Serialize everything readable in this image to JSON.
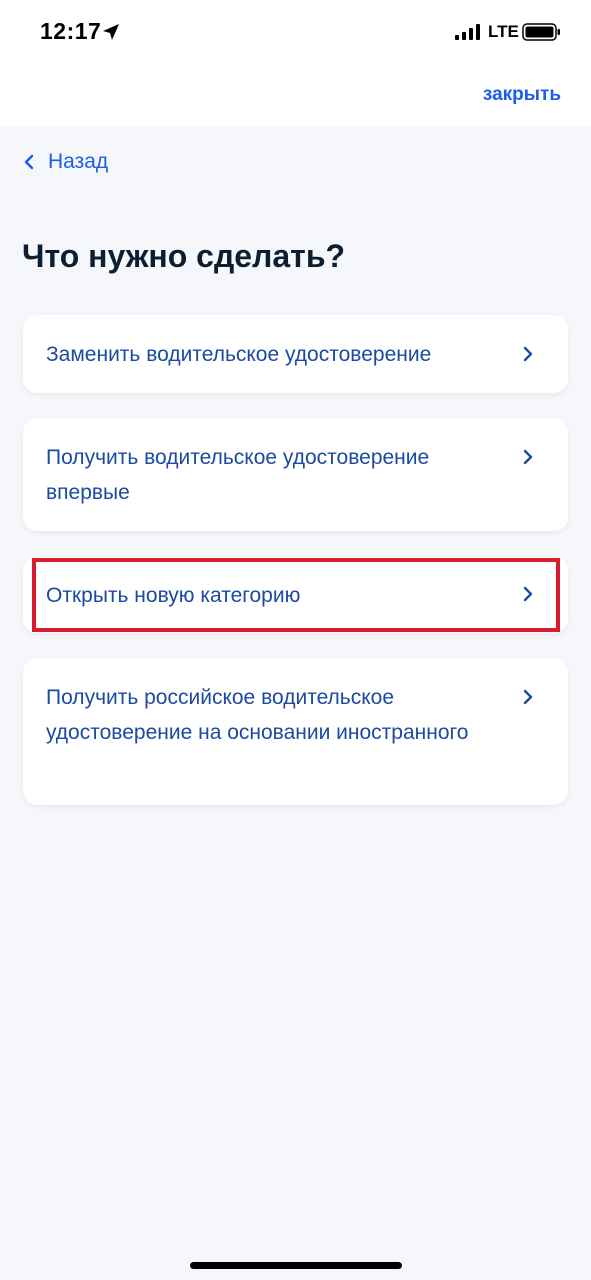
{
  "status_bar": {
    "time": "12:17",
    "network": "LTE",
    "location_icon": "location-arrow-icon",
    "signal_icon": "cellular-signal-icon",
    "battery_icon": "battery-icon"
  },
  "nav": {
    "close_label": "закрыть"
  },
  "back": {
    "label": "Назад",
    "icon": "chevron-left-icon"
  },
  "page": {
    "title": "Что нужно сделать?"
  },
  "options": [
    {
      "label": "Заменить водительское удостоверение"
    },
    {
      "label": "Получить водительское удостоверение впервые"
    },
    {
      "label": "Открыть новую категорию",
      "highlighted": true
    },
    {
      "label": "Получить российское водительское удостоверение на основании иностранного"
    }
  ],
  "colors": {
    "accent": "#1d5deb",
    "option_text": "#1c4aa3",
    "title": "#0b1f33",
    "background": "#f5f7fb",
    "highlight_border": "#d81e2c"
  }
}
